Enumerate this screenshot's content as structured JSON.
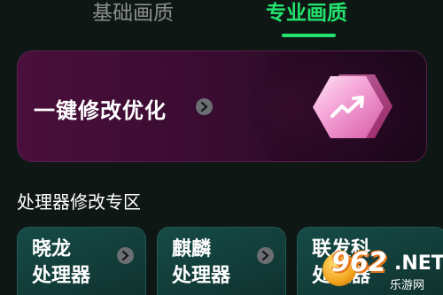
{
  "tabs": [
    {
      "label": "基础画质",
      "active": false
    },
    {
      "label": "专业画质",
      "active": true
    }
  ],
  "optimize_card": {
    "title": "一键修改优化",
    "icon": "trend-up-icon"
  },
  "section": {
    "title": "处理器修改专区",
    "cards": [
      {
        "line1": "晓龙",
        "line2": "处理器"
      },
      {
        "line1": "麒麟",
        "line2": "处理器"
      },
      {
        "line1": "联发科",
        "line2": "处理器"
      }
    ]
  },
  "watermark": {
    "logo_text": "962",
    "net": ".NET",
    "sub": "乐游网"
  },
  "colors": {
    "accent": "#22e36d",
    "background": "#0f1714",
    "card_purple": "#4a0f3c",
    "card_teal": "#164b46"
  }
}
